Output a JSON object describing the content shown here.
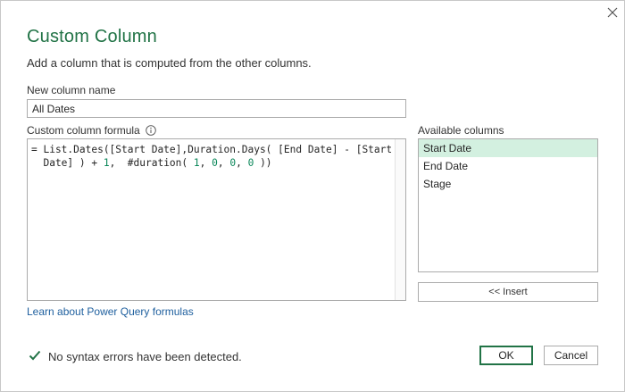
{
  "dialog": {
    "title": "Custom Column",
    "subtitle": "Add a column that is computed from the other columns."
  },
  "new_column": {
    "label": "New column name",
    "value": "All Dates"
  },
  "formula": {
    "label": "Custom column formula",
    "line1_a": "= List.Dates([Start Date],Duration.Days( [End Date] - [Start",
    "line2_a": "  Date] ) + ",
    "line2_n1": "1",
    "line2_b": ",  #duration( ",
    "line2_n2": "1",
    "line2_c": ", ",
    "line2_n3": "0",
    "line2_d": ", ",
    "line2_n4": "0",
    "line2_e": ", ",
    "line2_n5": "0",
    "line2_f": " ))"
  },
  "available_columns": {
    "label": "Available columns",
    "items": [
      "Start Date",
      "End Date",
      "Stage"
    ],
    "selected_index": 0,
    "insert_label": "<< Insert"
  },
  "learn_link": "Learn about Power Query formulas",
  "status": {
    "text": "No syntax errors have been detected."
  },
  "buttons": {
    "ok": "OK",
    "cancel": "Cancel"
  },
  "colors": {
    "accent": "#217346",
    "selection": "#d3f0e0",
    "link": "#1e5f9e",
    "number": "#098658"
  },
  "icons": {
    "close": "close-icon",
    "info": "info-icon",
    "status": "checkmark-icon"
  }
}
